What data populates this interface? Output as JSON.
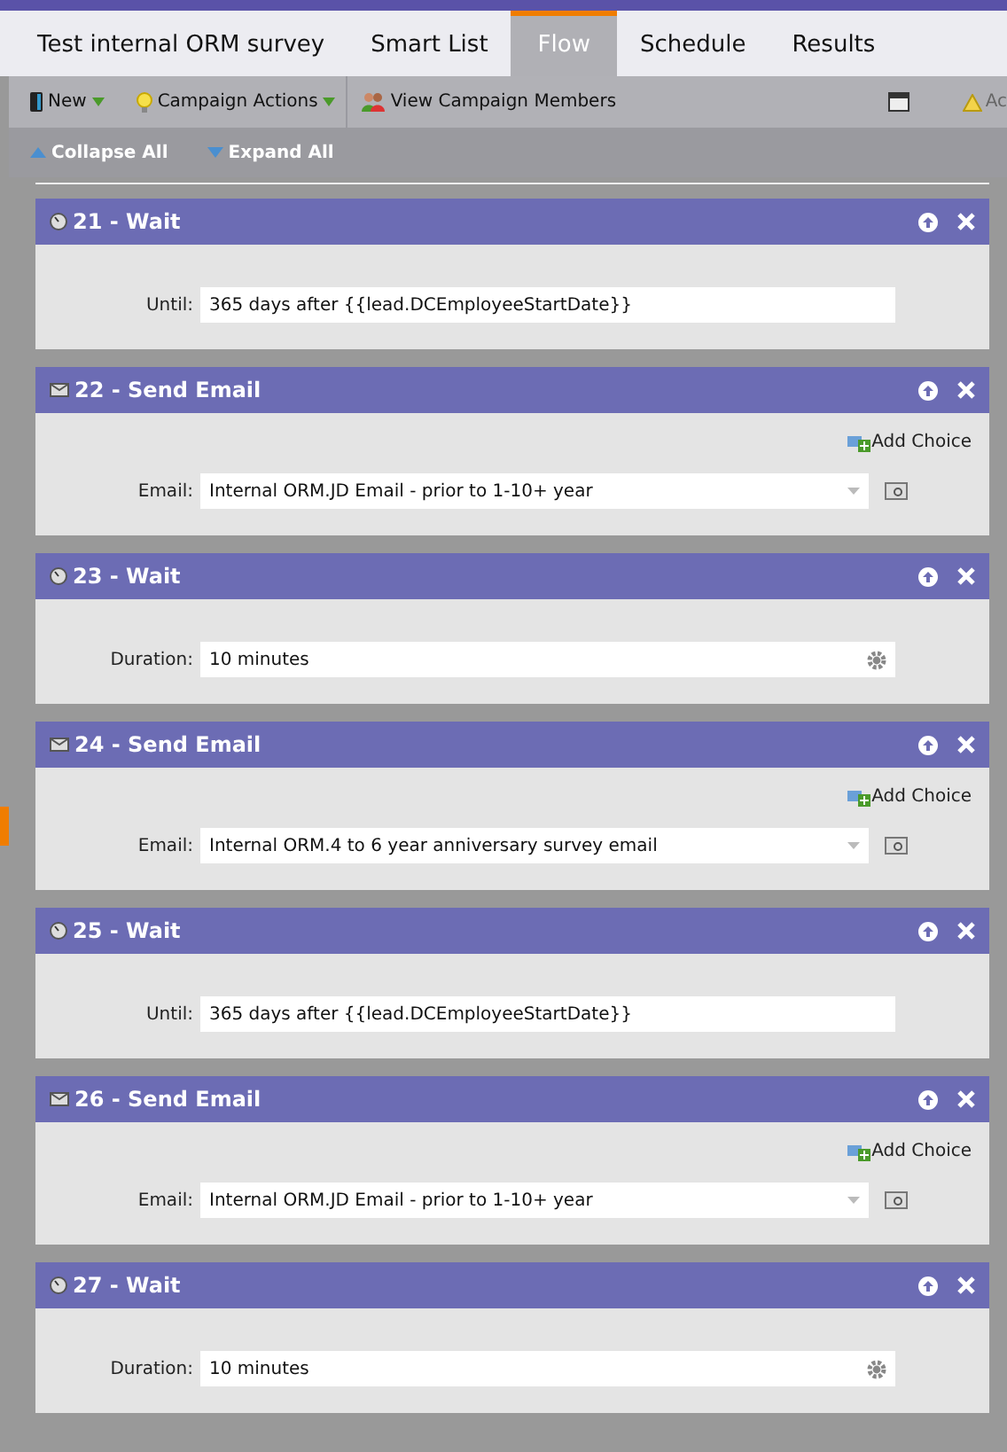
{
  "tabs": [
    {
      "label": "Test internal ORM survey",
      "selected": false
    },
    {
      "label": "Smart List",
      "selected": false
    },
    {
      "label": "Flow",
      "selected": true
    },
    {
      "label": "Schedule",
      "selected": false
    },
    {
      "label": "Results",
      "selected": false
    }
  ],
  "toolbar": {
    "new": "New",
    "campaign_actions": "Campaign Actions",
    "view_members": "View Campaign Members",
    "activation": "Ac"
  },
  "outline": {
    "collapse": "Collapse All",
    "expand": "Expand All"
  },
  "steps": [
    {
      "kind": "wait",
      "title": "21 - Wait",
      "label": "Until:",
      "value": "365 days after {{lead.DCEmployeeStartDate}}",
      "settings": false
    },
    {
      "kind": "email",
      "title": "22 - Send Email",
      "add_choice": "Add Choice",
      "label": "Email:",
      "value": "Internal ORM.JD Email - prior to 1-10+ year"
    },
    {
      "kind": "wait",
      "title": "23 - Wait",
      "label": "Duration:",
      "value": "10 minutes",
      "settings": true
    },
    {
      "kind": "email",
      "title": "24 - Send Email",
      "add_choice": "Add Choice",
      "label": "Email:",
      "value": "Internal ORM.4 to 6 year anniversary survey email"
    },
    {
      "kind": "wait",
      "title": "25 - Wait",
      "label": "Until:",
      "value": "365 days after {{lead.DCEmployeeStartDate}}",
      "settings": false
    },
    {
      "kind": "email",
      "title": "26 - Send Email",
      "add_choice": "Add Choice",
      "label": "Email:",
      "value": "Internal ORM.JD Email - prior to 1-10+ year"
    },
    {
      "kind": "wait",
      "title": "27 - Wait",
      "label": "Duration:",
      "value": "10 minutes",
      "settings": true
    }
  ]
}
